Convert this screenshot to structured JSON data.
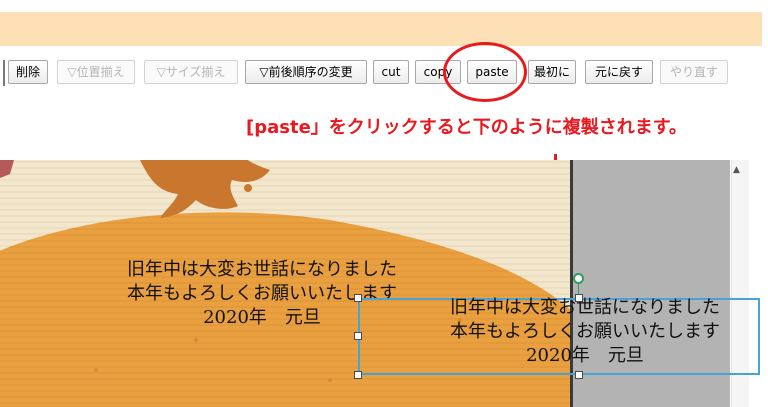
{
  "toolbar": {
    "buttons": [
      {
        "label": "削除",
        "disabled": false
      },
      {
        "label": "▽位置揃え",
        "disabled": true
      },
      {
        "label": "▽サイズ揃え",
        "disabled": true
      },
      {
        "label": "▽前後順序の変更",
        "disabled": false
      },
      {
        "label": "cut",
        "disabled": false
      },
      {
        "label": "copy",
        "disabled": false
      },
      {
        "label": "paste",
        "disabled": false
      },
      {
        "label": "最初に",
        "disabled": false
      },
      {
        "label": "元に戻す",
        "disabled": false
      },
      {
        "label": "やり直す",
        "disabled": true
      }
    ]
  },
  "annotation": {
    "text": "[paste」をクリックすると下のように複製されます。",
    "color": "#e8191f"
  },
  "canvas": {
    "original_text": [
      "旧年中は大変お世話になりました",
      "本年もよろしくお願いいたします",
      "2020年　元旦"
    ],
    "pasted_text": [
      "旧年中は大変お世話になりました",
      "本年もよろしくお願いいたします",
      "2020年　元旦"
    ],
    "selection_color": "#4aa3d8",
    "background_colors": {
      "paper": "#f2e6cc",
      "orange": "#e9a040",
      "brown": "#c9772f"
    }
  },
  "icons": {
    "scroll_up": "▲"
  }
}
